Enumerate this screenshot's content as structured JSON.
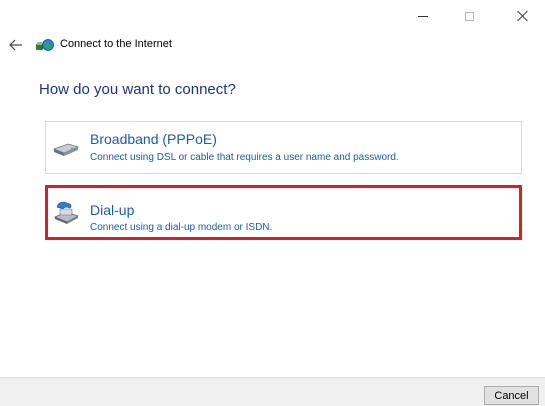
{
  "window": {
    "title": "Connect to the Internet",
    "controls": [
      "minimize-icon",
      "maximize-icon",
      "close-icon"
    ]
  },
  "nav": {
    "back_icon": "back-arrow-icon",
    "app_icon": "network-globe-icon"
  },
  "main": {
    "heading": "How do you want to connect?",
    "options": [
      {
        "title": "Broadband (PPPoE)",
        "description": "Connect using DSL or cable that requires a user name and password.",
        "icon": "broadband-modem-icon",
        "highlighted": false
      },
      {
        "title": "Dial-up",
        "description": "Connect using a dial-up modem or ISDN.",
        "icon": "dialup-phone-icon",
        "highlighted": true
      }
    ]
  },
  "footer": {
    "cancel_label": "Cancel"
  },
  "colors": {
    "heading": "#1e3287",
    "link": "#1a5dab",
    "option_border": "#c7dcee",
    "highlight_border": "#e21b23",
    "footer_bg": "#f0f0f0"
  }
}
